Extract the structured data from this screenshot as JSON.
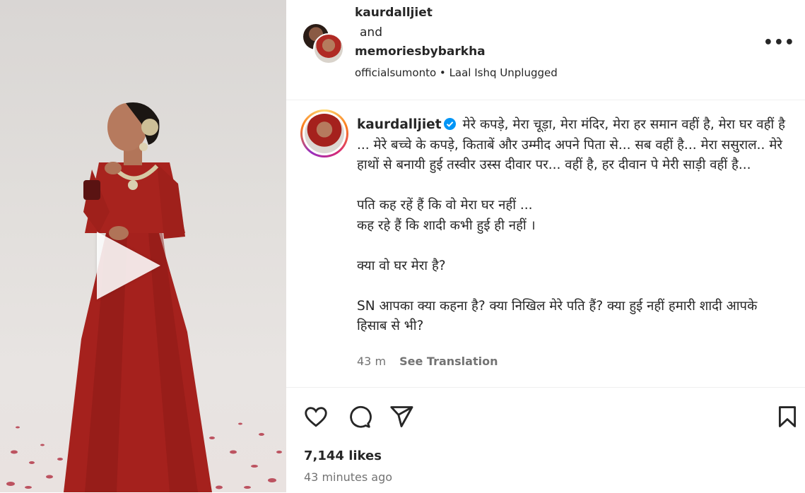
{
  "post": {
    "author_primary": "kaurdalljiet",
    "and_text": "and",
    "author_collab": "memoriesbybarkha",
    "audio_artist": "officialsumonto",
    "separator": "•",
    "audio_title": "Laal Ishq Unplugged",
    "more_label": "•••"
  },
  "caption": {
    "author": "kaurdalljiet",
    "lines": [
      "मेरे कपड़े, मेरा चूड़ा, मेरा मंदिर, मेरा हर समान वहीं है, मेरा घर वहीं है ... मेरे बच्चे के कपड़े, किताबें और उम्मीद अपने पिता से... सब वहीं है... मेरा ससुराल.. मेरे हाथों से बनायी हुई तस्वीर उस्स दीवार पर... वहीं है, हर दीवान पे मेरी साड़ी वहीं है...",
      "पति कह रहें हैं कि वो मेरा घर नहीं ...",
      "कह रहे हैं कि शादी कभी हुई ही नहीं ।",
      "क्या वो घर मेरा है?",
      "SN आपका क्या कहना है? क्या निखिल मेरे पति हैं? क्या हुई नहीं हमारी शादी आपके हिसाब से भी?"
    ],
    "time": "43 m",
    "see_translation": "See Translation"
  },
  "stats": {
    "likes": "7,144 likes",
    "posted": "43 minutes ago"
  },
  "colors": {
    "verified": "#0095f6",
    "dress": "#a5211d",
    "secondary_text": "#737373"
  },
  "icons": [
    "heart-icon",
    "comment-icon",
    "share-icon",
    "bookmark-icon",
    "play-icon",
    "verified-icon",
    "more-icon"
  ]
}
